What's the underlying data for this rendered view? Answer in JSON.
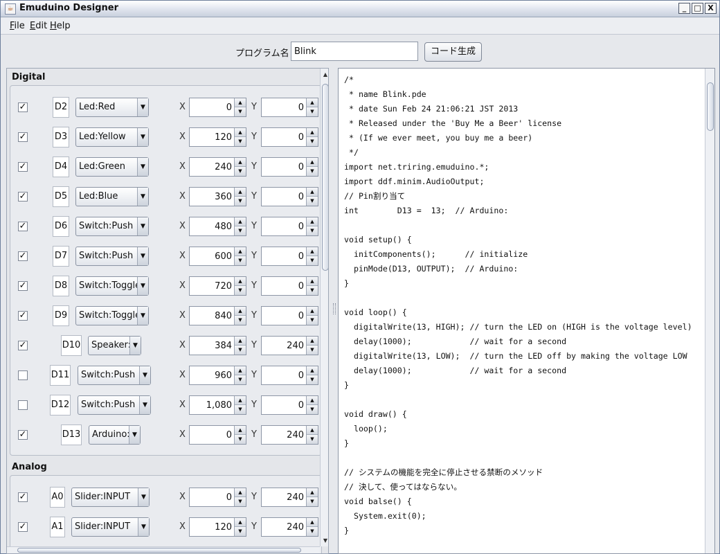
{
  "window": {
    "title": "Emuduino Designer",
    "minimize": "_",
    "maximize": "□",
    "close": "X"
  },
  "menu": [
    {
      "key": "F",
      "rest": "ile"
    },
    {
      "key": "E",
      "rest": "dit"
    },
    {
      "key": "H",
      "rest": "elp"
    }
  ],
  "program": {
    "label": "プログラム名",
    "value": "Blink",
    "generate_button": "コード生成"
  },
  "digital": {
    "title": "Digital",
    "rows": [
      {
        "checked": true,
        "pin": "D2",
        "component": "Led:Red",
        "x": "0",
        "y": "0"
      },
      {
        "checked": true,
        "pin": "D3",
        "component": "Led:Yellow",
        "x": "120",
        "y": "0"
      },
      {
        "checked": true,
        "pin": "D4",
        "component": "Led:Green",
        "x": "240",
        "y": "0"
      },
      {
        "checked": true,
        "pin": "D5",
        "component": "Led:Blue",
        "x": "360",
        "y": "0"
      },
      {
        "checked": true,
        "pin": "D6",
        "component": "Switch:Push",
        "x": "480",
        "y": "0"
      },
      {
        "checked": true,
        "pin": "D7",
        "component": "Switch:Push",
        "x": "600",
        "y": "0"
      },
      {
        "checked": true,
        "pin": "D8",
        "component": "Switch:Toggle",
        "x": "720",
        "y": "0"
      },
      {
        "checked": true,
        "pin": "D9",
        "component": "Switch:Toggle",
        "x": "840",
        "y": "0"
      },
      {
        "checked": true,
        "pin": "D10",
        "component": "Speaker:",
        "x": "384",
        "y": "240"
      },
      {
        "checked": false,
        "pin": "D11",
        "component": "Switch:Push",
        "x": "960",
        "y": "0"
      },
      {
        "checked": false,
        "pin": "D12",
        "component": "Switch:Push",
        "x": "1,080",
        "y": "0"
      },
      {
        "checked": true,
        "pin": "D13",
        "component": "Arduino:",
        "x": "0",
        "y": "240"
      }
    ]
  },
  "analog": {
    "title": "Analog",
    "rows": [
      {
        "checked": true,
        "pin": "A0",
        "component": "Slider:INPUT",
        "x": "0",
        "y": "240"
      },
      {
        "checked": true,
        "pin": "A1",
        "component": "Slider:INPUT",
        "x": "120",
        "y": "240"
      }
    ]
  },
  "labels": {
    "x_axis": "X",
    "y_axis": "Y",
    "check_mark": "✓",
    "spin_up": "▲",
    "spin_down": "▼",
    "combo_arrow": "▼"
  },
  "code_lines": [
    "/*",
    " * name Blink.pde",
    " * date Sun Feb 24 21:06:21 JST 2013",
    " * Released under the 'Buy Me a Beer' license",
    " * (If we ever meet, you buy me a beer)",
    " */",
    "import net.triring.emuduino.*;",
    "import ddf.minim.AudioOutput;",
    "// Pin割り当て",
    "int        D13 =  13;  // Arduino:",
    "",
    "void setup() {",
    "  initComponents();      // initialize",
    "  pinMode(D13, OUTPUT);  // Arduino:",
    "}",
    "",
    "void loop() {",
    "  digitalWrite(13, HIGH); // turn the LED on (HIGH is the voltage level)",
    "  delay(1000);            // wait for a second",
    "  digitalWrite(13, LOW);  // turn the LED off by making the voltage LOW",
    "  delay(1000);            // wait for a second",
    "}",
    "",
    "void draw() {",
    "  loop();",
    "}",
    "",
    "// システムの機能を完全に停止させる禁断のメソッド",
    "// 決して、使ってはならない。",
    "void balse() {",
    "  System.exit(0);",
    "}"
  ]
}
